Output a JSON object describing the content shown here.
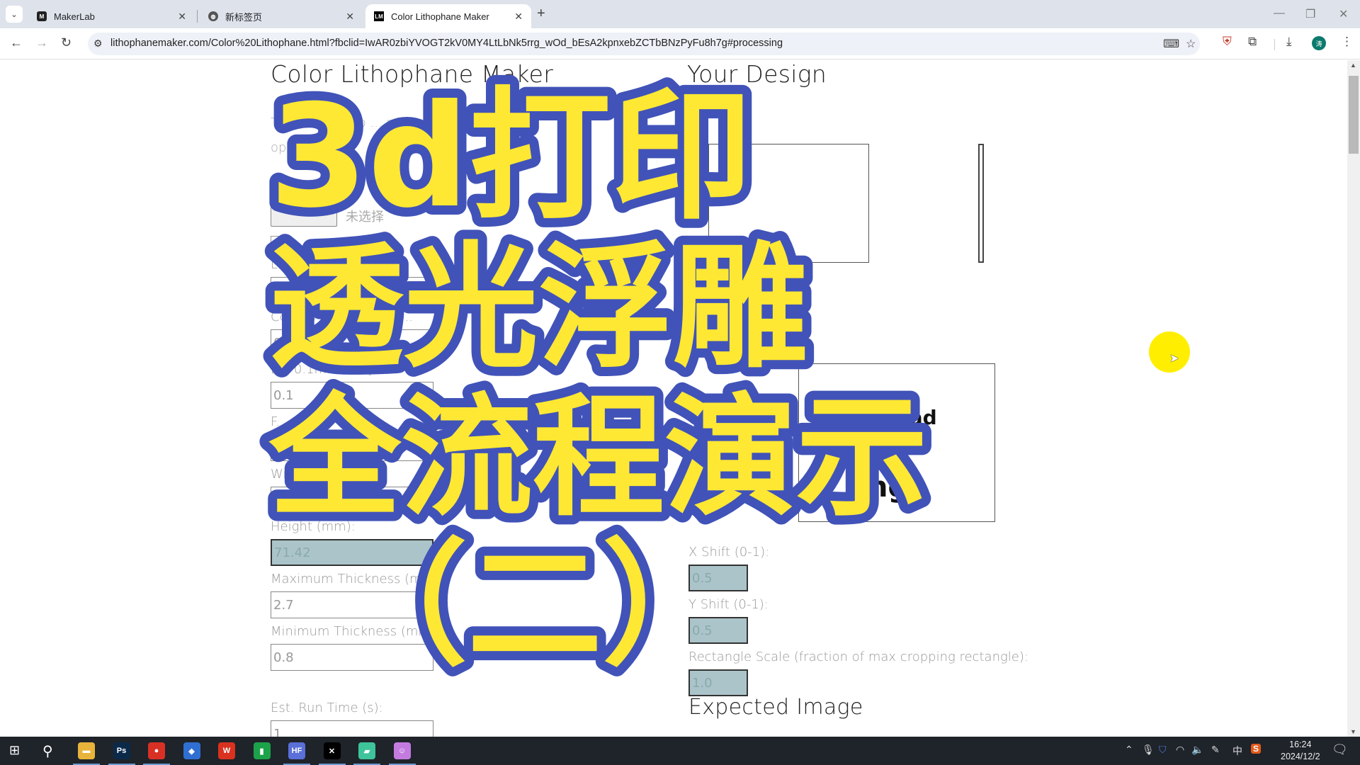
{
  "browser": {
    "tabs": [
      {
        "label": "MakerLab",
        "favicon": "makerlab-icon",
        "active": false
      },
      {
        "label": "新标签页",
        "favicon": "globe-icon",
        "active": false
      },
      {
        "label": "Color Lithophane Maker",
        "favicon": "LM",
        "active": true
      }
    ],
    "new_tab": "+",
    "url": "lithophanemaker.com/Color%20Lithophane.html?fbclid=IwAR0zbiYVOGT2kV0MY4LtLbNk5rrg_wOd_bEsA2kpnxebZCTbBNzPyFu8h7g#processing",
    "window_controls": {
      "minimize": "—",
      "restore": "❐",
      "close": "✕"
    }
  },
  "page": {
    "left_title": "Color Lithophane Maker",
    "right_title": "Your Design",
    "intro_line1": "T... picture into ... ne ... th...",
    "intro_line2": "op... w...",
    "upload_label": "U... ad...",
    "file_status": "未选择",
    "fields": [
      {
        "label": "Lit... m...",
        "value": "",
        "disabled": false
      },
      {
        "label": "Co... n) [2 ... e width...",
        "value": "0.8",
        "disabled": false
      },
      {
        "label": "L... 0.1mm ... d]:",
        "value": "0.1",
        "disabled": false
      },
      {
        "label": "F...",
        "value": "",
        "disabled": false
      },
      {
        "label": "Wid...",
        "value": "9...",
        "disabled": false
      },
      {
        "label": "Height (mm):",
        "value": "71.42",
        "disabled": true
      },
      {
        "label": "Maximum Thickness (mm):",
        "value": "2.7",
        "disabled": false
      },
      {
        "label": "Minimum Thickness (mm):",
        "value": "0.8",
        "disabled": false
      }
    ],
    "run_time": {
      "label": "Est. Run Time (s):",
      "value": "1"
    },
    "right_fields": [
      {
        "label": "X Shift (0-1):",
        "value": "0.5"
      },
      {
        "label": "Y Shift (0-1):",
        "value": "0.5"
      },
      {
        "label": "Rectangle Scale (fraction of max cropping rectangle):",
        "value": "1.0"
      }
    ],
    "expected_image_title": "Expected Image",
    "partial_text_1": "nload",
    "partial_text_2": "ng"
  },
  "overlay": {
    "line1": "3d打印",
    "line2": "透光浮雕",
    "line3": "全流程演示",
    "line4": "（二）",
    "fill": "#ffe833",
    "stroke": "#4153b8"
  },
  "taskbar": {
    "apps": [
      {
        "name": "file-explorer-icon",
        "glyph": "▬",
        "color": "#e8b33a"
      },
      {
        "name": "photoshop-icon",
        "glyph": "Ps",
        "color": "#0b2a4a"
      },
      {
        "name": "chrome-icon",
        "glyph": "●",
        "color": "#d93025"
      },
      {
        "name": "cube-app-icon",
        "glyph": "◆",
        "color": "#2f6fd1"
      },
      {
        "name": "wps-icon",
        "glyph": "W",
        "color": "#d9321f"
      },
      {
        "name": "spreadsheet-icon",
        "glyph": "▮",
        "color": "#1ca34a"
      },
      {
        "name": "colorful-app-icon",
        "glyph": "HF",
        "color": "#5b6fd8"
      },
      {
        "name": "capcut-icon",
        "glyph": "✕",
        "color": "#000000"
      },
      {
        "name": "notes-app-icon",
        "glyph": "▰",
        "color": "#3ec39a"
      },
      {
        "name": "cat-app-icon",
        "glyph": "☺",
        "color": "#c47be0"
      }
    ],
    "tray": {
      "ime": "中",
      "time": "16:24",
      "date": "2024/12/2"
    }
  }
}
